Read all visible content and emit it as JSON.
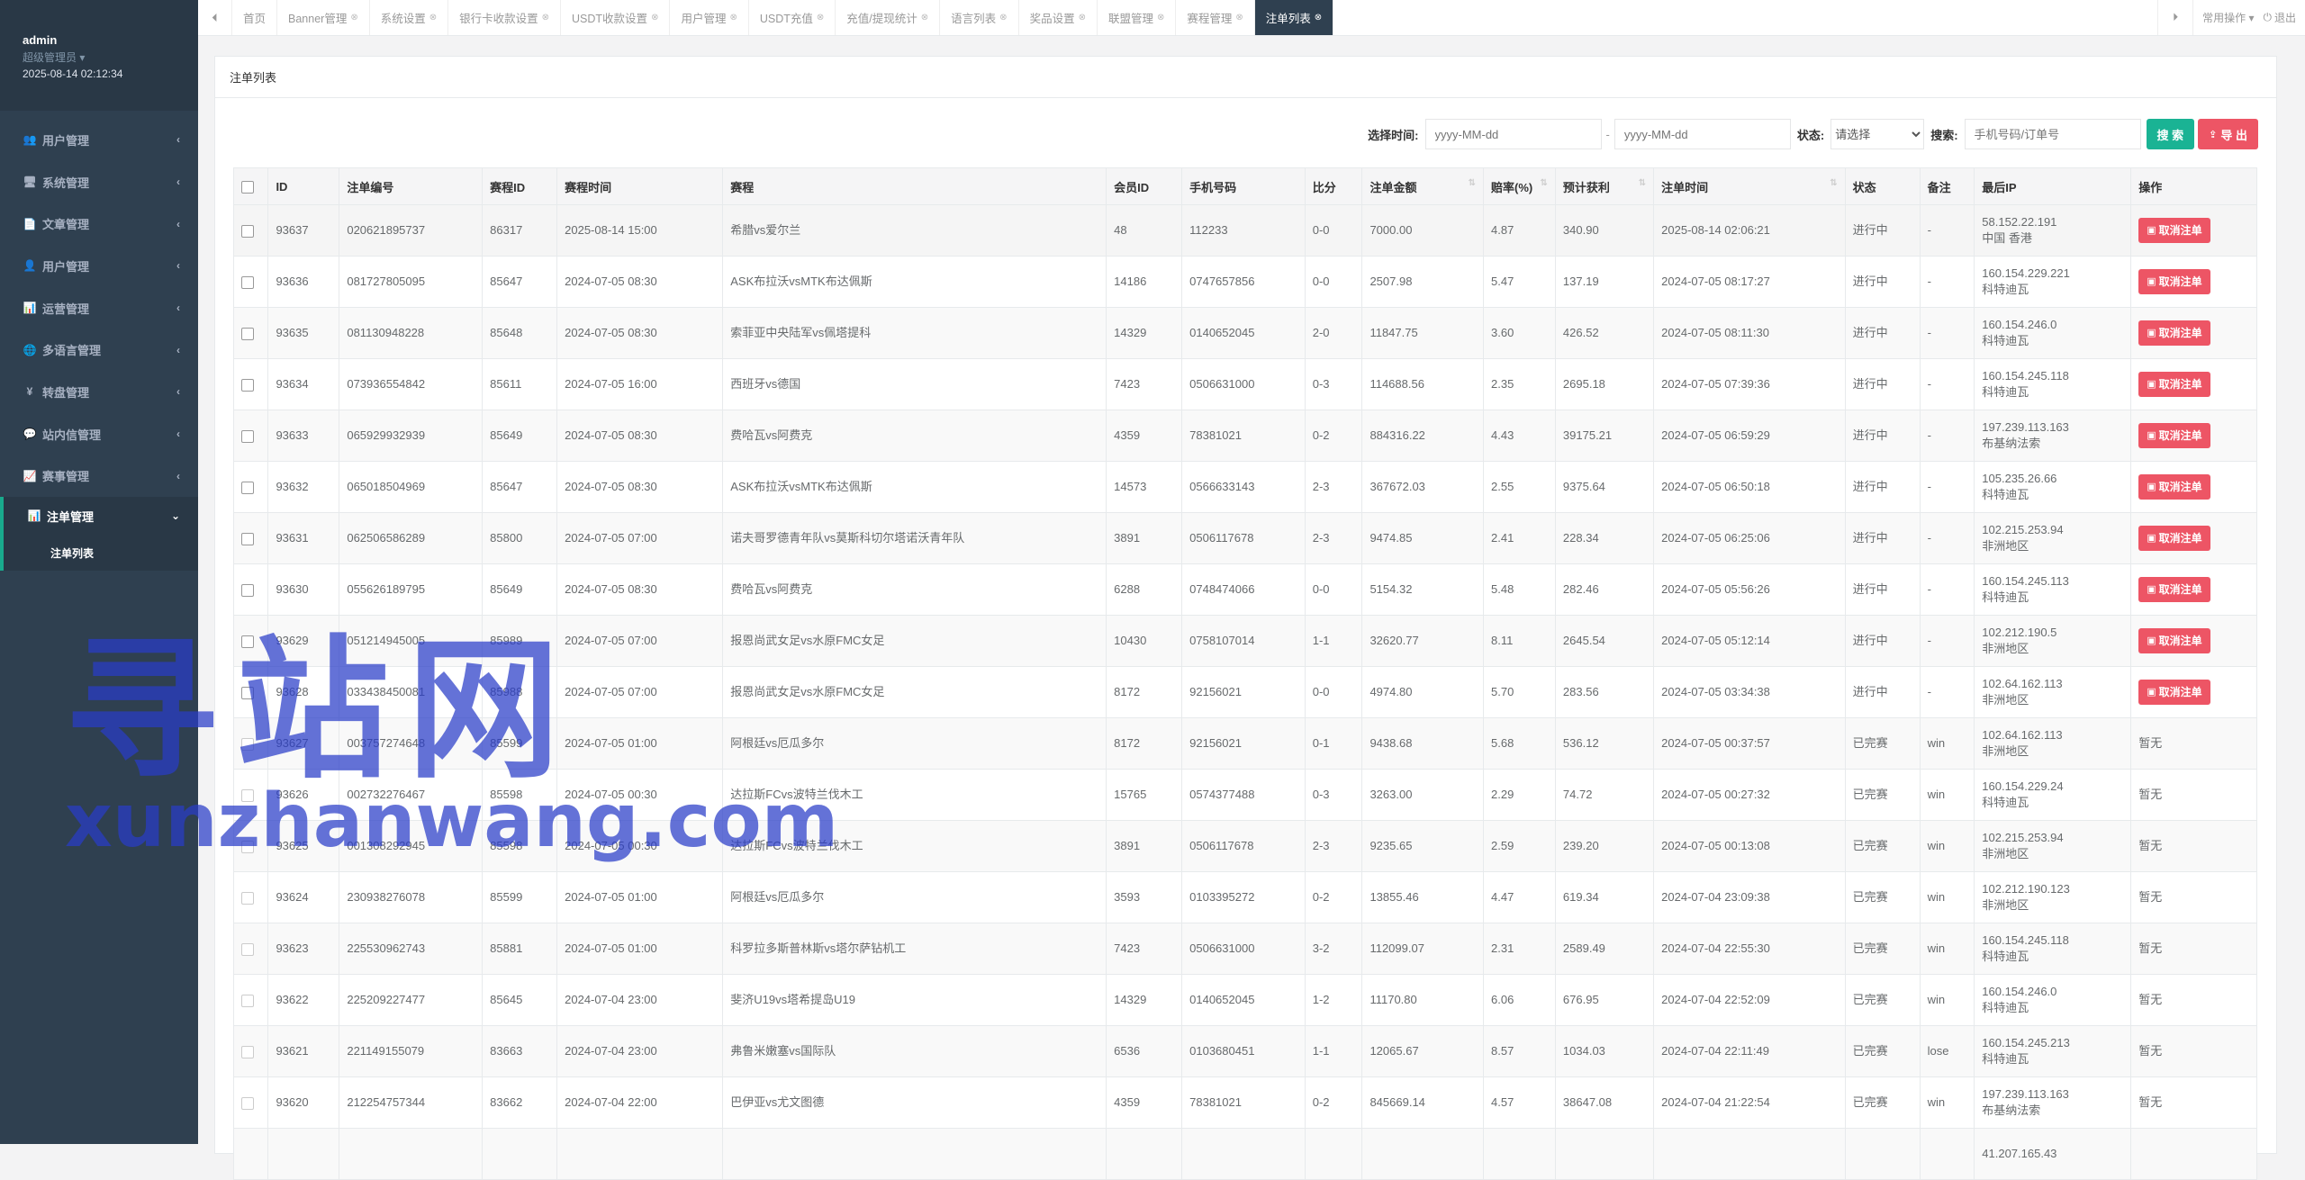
{
  "profile": {
    "name": "admin",
    "role": "超级管理员 ▾",
    "time": "2025-08-14 02:12:34"
  },
  "sidebar": {
    "items": [
      {
        "label": "用户管理",
        "icon": "users-icon",
        "glyph": "👥"
      },
      {
        "label": "系统管理",
        "icon": "monitor-icon",
        "glyph": "🖥"
      },
      {
        "label": "文章管理",
        "icon": "file-icon",
        "glyph": "📄"
      },
      {
        "label": "用户管理",
        "icon": "user-icon",
        "glyph": "👤"
      },
      {
        "label": "运营管理",
        "icon": "bar-chart-icon",
        "glyph": "📊"
      },
      {
        "label": "多语言管理",
        "icon": "globe-icon",
        "glyph": "🌐"
      },
      {
        "label": "转盘管理",
        "icon": "yen-icon",
        "glyph": "¥"
      },
      {
        "label": "站内信管理",
        "icon": "comment-icon",
        "glyph": "💬"
      },
      {
        "label": "赛事管理",
        "icon": "chart-icon",
        "glyph": "📈"
      }
    ],
    "active": {
      "label": "注单管理",
      "icon": "bar-chart-icon",
      "glyph": "📊"
    },
    "sub": "注单列表"
  },
  "tabs": [
    "首页",
    "Banner管理",
    "系统设置",
    "银行卡收款设置",
    "USDT收款设置",
    "用户管理",
    "USDT充值",
    "充值/提现统计",
    "语言列表",
    "奖品设置",
    "联盟管理",
    "赛程管理"
  ],
  "active_tab": "注单列表",
  "tools": {
    "ops": "常用操作 ▾",
    "logout": "退出"
  },
  "panel_title": "注单列表",
  "filter": {
    "time_label": "选择时间:",
    "date_placeholder": "yyyy-MM-dd",
    "status_label": "状态:",
    "status_value": "请选择",
    "search_label": "搜索:",
    "search_placeholder": "手机号码/订单号",
    "search_btn": "搜 索",
    "export_btn": "导 出"
  },
  "table": {
    "headers": [
      "ID",
      "注单编号",
      "赛程ID",
      "赛程时间",
      "赛程",
      "会员ID",
      "手机号码",
      "比分",
      "注单金额",
      "赔率(%)",
      "预计获利",
      "注单时间",
      "状态",
      "备注",
      "最后IP",
      "操作"
    ],
    "cancel_label": "取消注单",
    "rows": [
      [
        "93637",
        "020621895737",
        "86317",
        "2025-08-14 15:00",
        "希腊vs爱尔兰",
        "48",
        "112233",
        "0-0",
        "7000.00",
        "4.87",
        "340.90",
        "2025-08-14 02:06:21",
        "进行中",
        "-",
        "58.152.22.191",
        "中国 香港",
        ""
      ],
      [
        "93636",
        "081727805095",
        "85647",
        "2024-07-05 08:30",
        "ASK布拉沃vsMTK布达佩斯",
        "14186",
        "0747657856",
        "0-0",
        "2507.98",
        "5.47",
        "137.19",
        "2024-07-05 08:17:27",
        "进行中",
        "-",
        "160.154.229.221",
        "科特迪瓦",
        ""
      ],
      [
        "93635",
        "081130948228",
        "85648",
        "2024-07-05 08:30",
        "索菲亚中央陆军vs佩塔提科",
        "14329",
        "0140652045",
        "2-0",
        "11847.75",
        "3.60",
        "426.52",
        "2024-07-05 08:11:30",
        "进行中",
        "-",
        "160.154.246.0",
        "科特迪瓦",
        ""
      ],
      [
        "93634",
        "073936554842",
        "85611",
        "2024-07-05 16:00",
        "西班牙vs德国",
        "7423",
        "0506631000",
        "0-3",
        "114688.56",
        "2.35",
        "2695.18",
        "2024-07-05 07:39:36",
        "进行中",
        "-",
        "160.154.245.118",
        "科特迪瓦",
        ""
      ],
      [
        "93633",
        "065929932939",
        "85649",
        "2024-07-05 08:30",
        "费哈瓦vs阿费克",
        "4359",
        "78381021",
        "0-2",
        "884316.22",
        "4.43",
        "39175.21",
        "2024-07-05 06:59:29",
        "进行中",
        "-",
        "197.239.113.163",
        "布基纳法索",
        ""
      ],
      [
        "93632",
        "065018504969",
        "85647",
        "2024-07-05 08:30",
        "ASK布拉沃vsMTK布达佩斯",
        "14573",
        "0566633143",
        "2-3",
        "367672.03",
        "2.55",
        "9375.64",
        "2024-07-05 06:50:18",
        "进行中",
        "-",
        "105.235.26.66",
        "科特迪瓦",
        ""
      ],
      [
        "93631",
        "062506586289",
        "85800",
        "2024-07-05 07:00",
        "诺夫哥罗德青年队vs莫斯科切尔塔诺沃青年队",
        "3891",
        "0506117678",
        "2-3",
        "9474.85",
        "2.41",
        "228.34",
        "2024-07-05 06:25:06",
        "进行中",
        "-",
        "102.215.253.94",
        "非洲地区",
        ""
      ],
      [
        "93630",
        "055626189795",
        "85649",
        "2024-07-05 08:30",
        "费哈瓦vs阿费克",
        "6288",
        "0748474066",
        "0-0",
        "5154.32",
        "5.48",
        "282.46",
        "2024-07-05 05:56:26",
        "进行中",
        "-",
        "160.154.245.113",
        "科特迪瓦",
        ""
      ],
      [
        "93629",
        "051214945005",
        "85989",
        "2024-07-05 07:00",
        "报恩尚武女足vs水原FMC女足",
        "10430",
        "0758107014",
        "1-1",
        "32620.77",
        "8.11",
        "2645.54",
        "2024-07-05 05:12:14",
        "进行中",
        "-",
        "102.212.190.5",
        "非洲地区",
        ""
      ],
      [
        "93628",
        "033438450081",
        "85988",
        "2024-07-05 07:00",
        "报恩尚武女足vs水原FMC女足",
        "8172",
        "92156021",
        "0-0",
        "4974.80",
        "5.70",
        "283.56",
        "2024-07-05 03:34:38",
        "进行中",
        "-",
        "102.64.162.113",
        "非洲地区",
        ""
      ],
      [
        "93627",
        "003757274648",
        "85599",
        "2024-07-05 01:00",
        "阿根廷vs厄瓜多尔",
        "8172",
        "92156021",
        "0-1",
        "9438.68",
        "5.68",
        "536.12",
        "2024-07-05 00:37:57",
        "已完赛",
        "win",
        "102.64.162.113",
        "非洲地区",
        "暂无"
      ],
      [
        "93626",
        "002732276467",
        "85598",
        "2024-07-05 00:30",
        "达拉斯FCvs波特兰伐木工",
        "15765",
        "0574377488",
        "0-3",
        "3263.00",
        "2.29",
        "74.72",
        "2024-07-05 00:27:32",
        "已完赛",
        "win",
        "160.154.229.24",
        "科特迪瓦",
        "暂无"
      ],
      [
        "93625",
        "001308292945",
        "85598",
        "2024-07-05 00:30",
        "达拉斯FCvs波特兰伐木工",
        "3891",
        "0506117678",
        "2-3",
        "9235.65",
        "2.59",
        "239.20",
        "2024-07-05 00:13:08",
        "已完赛",
        "win",
        "102.215.253.94",
        "非洲地区",
        "暂无"
      ],
      [
        "93624",
        "230938276078",
        "85599",
        "2024-07-05 01:00",
        "阿根廷vs厄瓜多尔",
        "3593",
        "0103395272",
        "0-2",
        "13855.46",
        "4.47",
        "619.34",
        "2024-07-04 23:09:38",
        "已完赛",
        "win",
        "102.212.190.123",
        "非洲地区",
        "暂无"
      ],
      [
        "93623",
        "225530962743",
        "85881",
        "2024-07-05 01:00",
        "科罗拉多斯普林斯vs塔尔萨钻机工",
        "7423",
        "0506631000",
        "3-2",
        "112099.07",
        "2.31",
        "2589.49",
        "2024-07-04 22:55:30",
        "已完赛",
        "win",
        "160.154.245.118",
        "科特迪瓦",
        "暂无"
      ],
      [
        "93622",
        "225209227477",
        "85645",
        "2024-07-04 23:00",
        "斐济U19vs塔希提岛U19",
        "14329",
        "0140652045",
        "1-2",
        "11170.80",
        "6.06",
        "676.95",
        "2024-07-04 22:52:09",
        "已完赛",
        "win",
        "160.154.246.0",
        "科特迪瓦",
        "暂无"
      ],
      [
        "93621",
        "221149155079",
        "83663",
        "2024-07-04 23:00",
        "弗鲁米嫩塞vs国际队",
        "6536",
        "0103680451",
        "1-1",
        "12065.67",
        "8.57",
        "1034.03",
        "2024-07-04 22:11:49",
        "已完赛",
        "lose",
        "160.154.245.213",
        "科特迪瓦",
        "暂无"
      ],
      [
        "93620",
        "212254757344",
        "83662",
        "2024-07-04 22:00",
        "巴伊亚vs尤文图德",
        "4359",
        "78381021",
        "0-2",
        "845669.14",
        "4.57",
        "38647.08",
        "2024-07-04 21:22:54",
        "已完赛",
        "win",
        "197.239.113.163",
        "布基纳法索",
        "暂无"
      ],
      [
        "",
        "",
        "",
        "",
        "",
        "",
        "",
        "",
        "",
        "",
        "",
        "",
        "",
        "",
        "41.207.165.43",
        "",
        ""
      ]
    ]
  },
  "watermark": {
    "cn": "寻站网",
    "en": "xunzhanwang.com"
  }
}
